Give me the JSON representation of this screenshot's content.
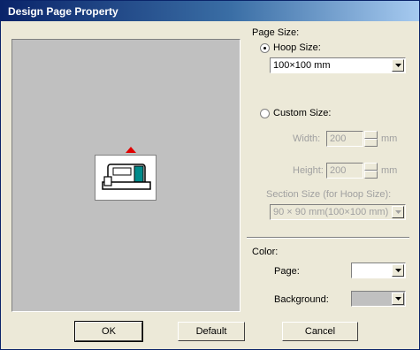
{
  "window": {
    "title": "Design Page Property"
  },
  "page_size": {
    "heading": "Page Size:",
    "hoop_label": "Hoop Size:",
    "hoop_value": "100×100 mm",
    "custom_label": "Custom Size:",
    "width_label": "Width:",
    "width_value": "200",
    "height_label": "Height:",
    "height_value": "200",
    "unit": "mm",
    "section_label": "Section Size (for Hoop Size):",
    "section_value": "90 × 90 mm(100×100 mm)"
  },
  "color": {
    "heading": "Color:",
    "page_label": "Page:",
    "page_color": "#ffffff",
    "background_label": "Background:",
    "background_color": "#c0c0c0"
  },
  "buttons": {
    "ok": "OK",
    "default": "Default",
    "cancel": "Cancel"
  },
  "colors": {
    "title_bar": "#0a246a",
    "dialog_face": "#ece9d8",
    "preview": "#c0c0c0",
    "arrow": "#e00000"
  }
}
